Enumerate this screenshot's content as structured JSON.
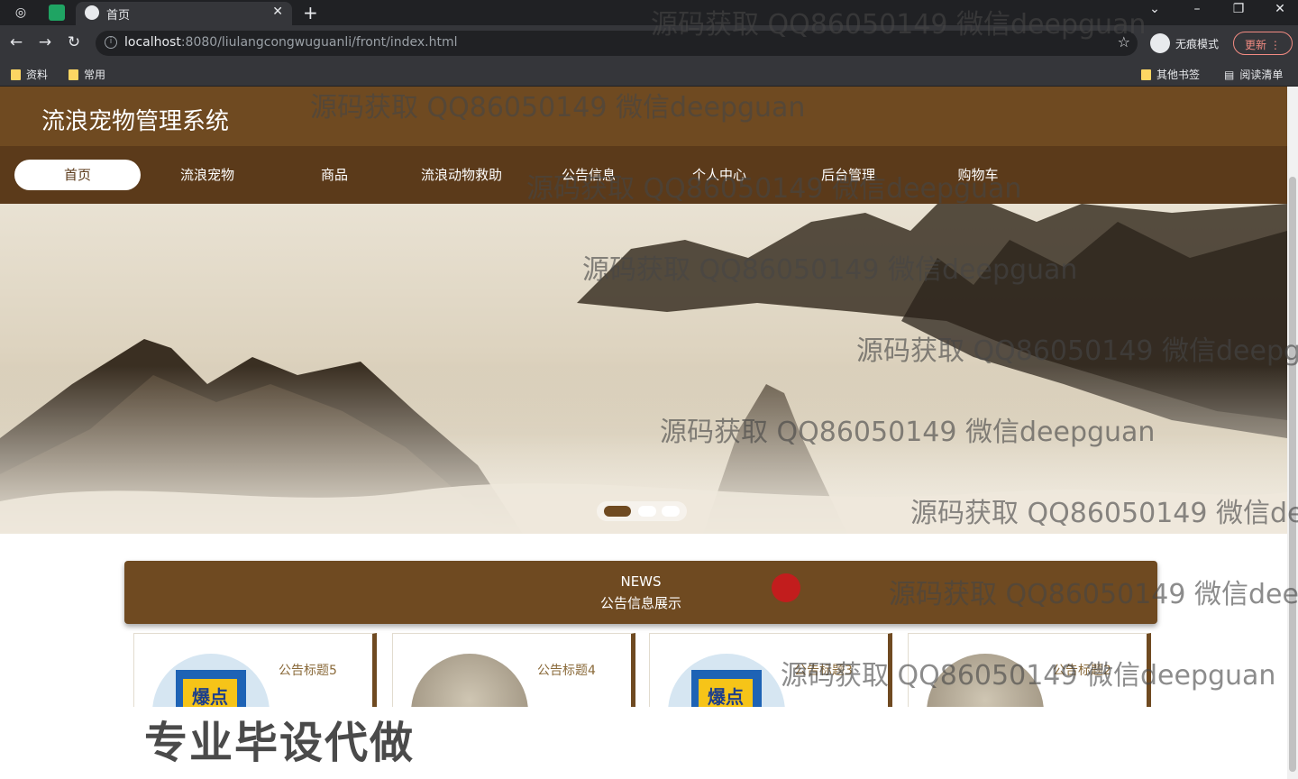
{
  "browser": {
    "tab_title": "首页",
    "url_host": "localhost",
    "url_path": ":8080/liulangcongwuguanli/front/index.html",
    "incognito_label": "无痕模式",
    "update_label": "更新",
    "bookmarks": [
      "资料",
      "常用"
    ],
    "other_bookmarks": "其他书签",
    "reading_list": "阅读清单"
  },
  "site": {
    "title": "流浪宠物管理系统",
    "nav": [
      "首页",
      "流浪宠物",
      "商品",
      "流浪动物救助",
      "公告信息",
      "个人中心",
      "后台管理",
      "购物车"
    ],
    "active_nav": "首页"
  },
  "banner": {
    "slide_count": 3,
    "active_slide": 1
  },
  "news": {
    "heading_en": "NEWS",
    "heading_cn": "公告信息展示",
    "cards": [
      {
        "title": "公告标题5",
        "image": "news"
      },
      {
        "title": "公告标题4",
        "image": "landscape"
      },
      {
        "title": "公告标题3",
        "image": "news"
      },
      {
        "title": "公告标题2",
        "image": "landscape"
      }
    ]
  },
  "overlay": {
    "watermark": "源码获取 QQ86050149 微信deepguan",
    "promo": "专业毕设代做",
    "stamp_text": "爆点"
  },
  "colors": {
    "header": "#6f4a21",
    "nav": "#5b3a1a"
  }
}
